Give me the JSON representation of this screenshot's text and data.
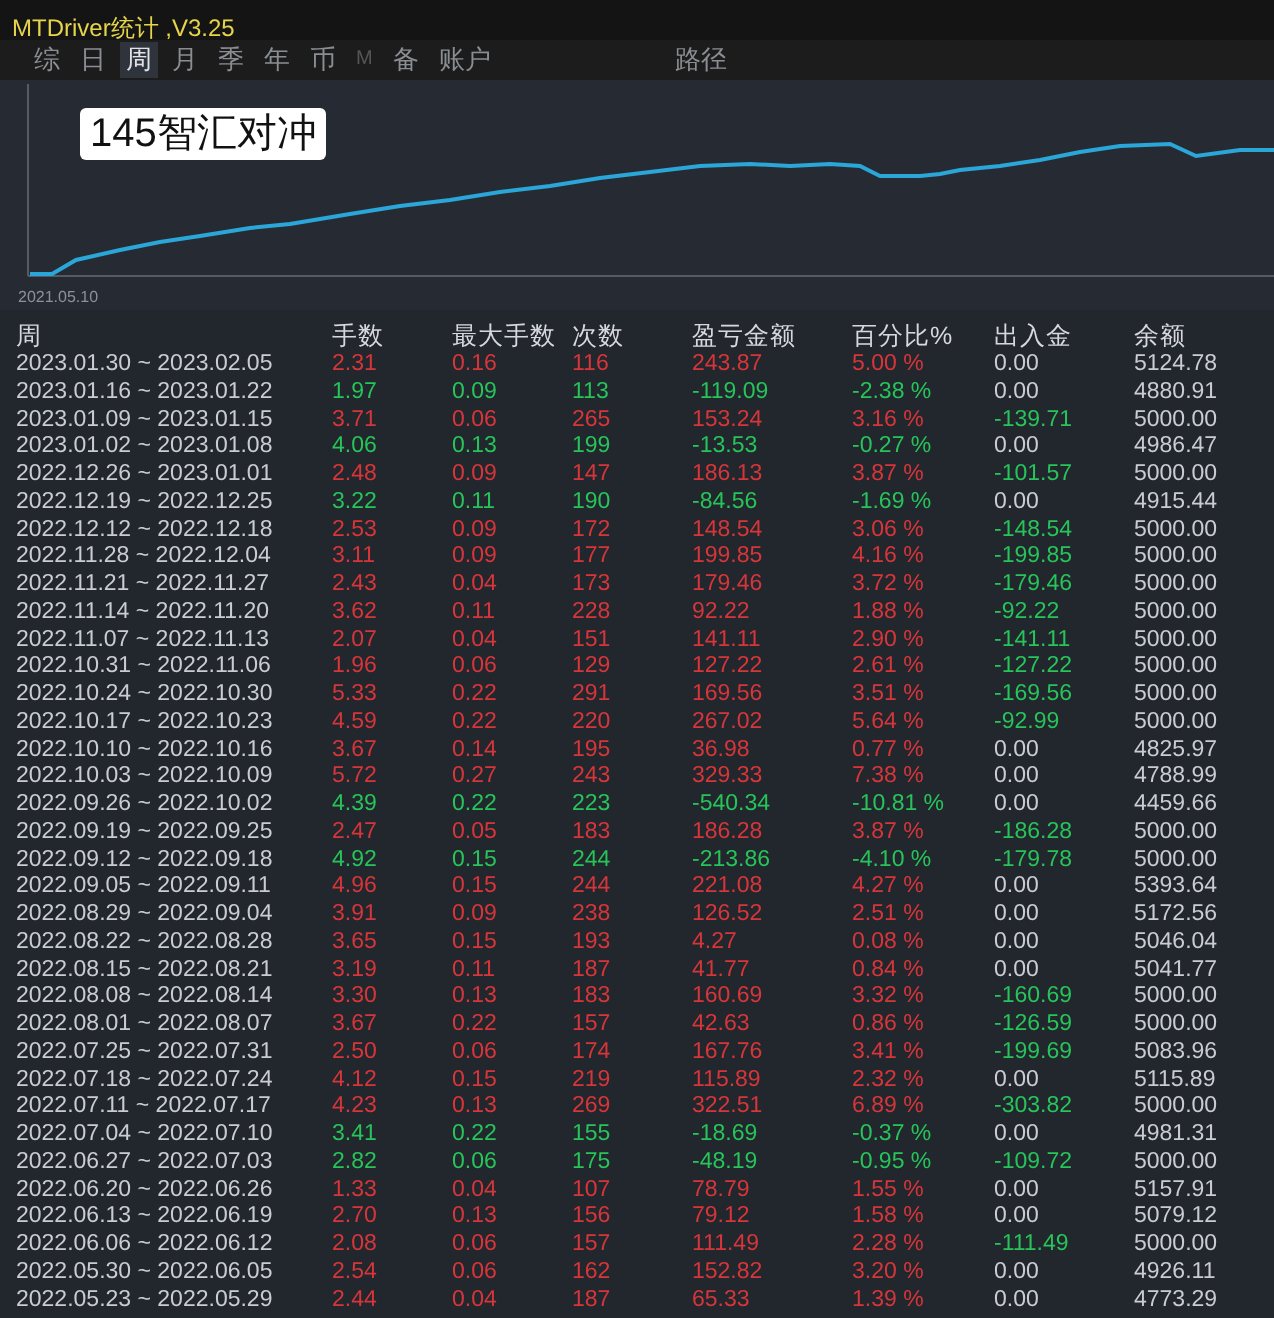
{
  "window": {
    "title": "MTDriver统计 ,V3.25"
  },
  "tabs": [
    {
      "label": "综",
      "selected": false,
      "disabled": false
    },
    {
      "label": "日",
      "selected": false,
      "disabled": false
    },
    {
      "label": "周",
      "selected": true,
      "disabled": false
    },
    {
      "label": "月",
      "selected": false,
      "disabled": false
    },
    {
      "label": "季",
      "selected": false,
      "disabled": false
    },
    {
      "label": "年",
      "selected": false,
      "disabled": false
    },
    {
      "label": "币",
      "selected": false,
      "disabled": false
    },
    {
      "label": "M",
      "selected": false,
      "disabled": true
    },
    {
      "label": "备",
      "selected": false,
      "disabled": false
    },
    {
      "label": "账户",
      "selected": false,
      "disabled": false
    },
    {
      "label": "路径",
      "selected": false,
      "disabled": false,
      "kind": "far"
    }
  ],
  "chart": {
    "account_label": "145智汇对冲",
    "start_date": "2021.05.10"
  },
  "table": {
    "columns": [
      "周",
      "手数",
      "最大手数",
      "次数",
      "盈亏金额",
      "百分比%",
      "出入金",
      "余额"
    ],
    "rows": [
      {
        "week": "2023.01.30 ~ 2023.02.05",
        "loss": false,
        "lots": "2.31",
        "max_lots": "0.16",
        "trades": "116",
        "pnl": "243.87",
        "percent": "5.00 %",
        "withdrawal": false,
        "flow": "0.00",
        "balance": "5124.78"
      },
      {
        "week": "2023.01.16 ~ 2023.01.22",
        "loss": true,
        "lots": "1.97",
        "max_lots": "0.09",
        "trades": "113",
        "pnl": "-119.09",
        "percent": "-2.38 %",
        "withdrawal": false,
        "flow": "0.00",
        "balance": "4880.91"
      },
      {
        "week": "2023.01.09 ~ 2023.01.15",
        "loss": false,
        "lots": "3.71",
        "max_lots": "0.06",
        "trades": "265",
        "pnl": "153.24",
        "percent": "3.16 %",
        "withdrawal": true,
        "flow": "-139.71",
        "balance": "5000.00"
      },
      {
        "week": "2023.01.02 ~ 2023.01.08",
        "loss": true,
        "lots": "4.06",
        "max_lots": "0.13",
        "trades": "199",
        "pnl": "-13.53",
        "percent": "-0.27 %",
        "withdrawal": false,
        "flow": "0.00",
        "balance": "4986.47"
      },
      {
        "week": "2022.12.26 ~ 2023.01.01",
        "loss": false,
        "lots": "2.48",
        "max_lots": "0.09",
        "trades": "147",
        "pnl": "186.13",
        "percent": "3.87 %",
        "withdrawal": true,
        "flow": "-101.57",
        "balance": "5000.00"
      },
      {
        "week": "2022.12.19 ~ 2022.12.25",
        "loss": true,
        "lots": "3.22",
        "max_lots": "0.11",
        "trades": "190",
        "pnl": "-84.56",
        "percent": "-1.69 %",
        "withdrawal": false,
        "flow": "0.00",
        "balance": "4915.44"
      },
      {
        "week": "2022.12.12 ~ 2022.12.18",
        "loss": false,
        "lots": "2.53",
        "max_lots": "0.09",
        "trades": "172",
        "pnl": "148.54",
        "percent": "3.06 %",
        "withdrawal": true,
        "flow": "-148.54",
        "balance": "5000.00"
      },
      {
        "week": "2022.11.28 ~ 2022.12.04",
        "loss": false,
        "lots": "3.11",
        "max_lots": "0.09",
        "trades": "177",
        "pnl": "199.85",
        "percent": "4.16 %",
        "withdrawal": true,
        "flow": "-199.85",
        "balance": "5000.00"
      },
      {
        "week": "2022.11.21 ~ 2022.11.27",
        "loss": false,
        "lots": "2.43",
        "max_lots": "0.04",
        "trades": "173",
        "pnl": "179.46",
        "percent": "3.72 %",
        "withdrawal": true,
        "flow": "-179.46",
        "balance": "5000.00"
      },
      {
        "week": "2022.11.14 ~ 2022.11.20",
        "loss": false,
        "lots": "3.62",
        "max_lots": "0.11",
        "trades": "228",
        "pnl": "92.22",
        "percent": "1.88 %",
        "withdrawal": true,
        "flow": "-92.22",
        "balance": "5000.00"
      },
      {
        "week": "2022.11.07 ~ 2022.11.13",
        "loss": false,
        "lots": "2.07",
        "max_lots": "0.04",
        "trades": "151",
        "pnl": "141.11",
        "percent": "2.90 %",
        "withdrawal": true,
        "flow": "-141.11",
        "balance": "5000.00"
      },
      {
        "week": "2022.10.31 ~ 2022.11.06",
        "loss": false,
        "lots": "1.96",
        "max_lots": "0.06",
        "trades": "129",
        "pnl": "127.22",
        "percent": "2.61 %",
        "withdrawal": true,
        "flow": "-127.22",
        "balance": "5000.00"
      },
      {
        "week": "2022.10.24 ~ 2022.10.30",
        "loss": false,
        "lots": "5.33",
        "max_lots": "0.22",
        "trades": "291",
        "pnl": "169.56",
        "percent": "3.51 %",
        "withdrawal": true,
        "flow": "-169.56",
        "balance": "5000.00"
      },
      {
        "week": "2022.10.17 ~ 2022.10.23",
        "loss": false,
        "lots": "4.59",
        "max_lots": "0.22",
        "trades": "220",
        "pnl": "267.02",
        "percent": "5.64 %",
        "withdrawal": true,
        "flow": "-92.99",
        "balance": "5000.00"
      },
      {
        "week": "2022.10.10 ~ 2022.10.16",
        "loss": false,
        "lots": "3.67",
        "max_lots": "0.14",
        "trades": "195",
        "pnl": "36.98",
        "percent": "0.77 %",
        "withdrawal": false,
        "flow": "0.00",
        "balance": "4825.97"
      },
      {
        "week": "2022.10.03 ~ 2022.10.09",
        "loss": false,
        "lots": "5.72",
        "max_lots": "0.27",
        "trades": "243",
        "pnl": "329.33",
        "percent": "7.38 %",
        "withdrawal": false,
        "flow": "0.00",
        "balance": "4788.99"
      },
      {
        "week": "2022.09.26 ~ 2022.10.02",
        "loss": true,
        "lots": "4.39",
        "max_lots": "0.22",
        "trades": "223",
        "pnl": "-540.34",
        "percent": "-10.81 %",
        "withdrawal": false,
        "flow": "0.00",
        "balance": "4459.66"
      },
      {
        "week": "2022.09.19 ~ 2022.09.25",
        "loss": false,
        "lots": "2.47",
        "max_lots": "0.05",
        "trades": "183",
        "pnl": "186.28",
        "percent": "3.87 %",
        "withdrawal": true,
        "flow": "-186.28",
        "balance": "5000.00"
      },
      {
        "week": "2022.09.12 ~ 2022.09.18",
        "loss": true,
        "lots": "4.92",
        "max_lots": "0.15",
        "trades": "244",
        "pnl": "-213.86",
        "percent": "-4.10 %",
        "withdrawal": true,
        "flow": "-179.78",
        "balance": "5000.00"
      },
      {
        "week": "2022.09.05 ~ 2022.09.11",
        "loss": false,
        "lots": "4.96",
        "max_lots": "0.15",
        "trades": "244",
        "pnl": "221.08",
        "percent": "4.27 %",
        "withdrawal": false,
        "flow": "0.00",
        "balance": "5393.64"
      },
      {
        "week": "2022.08.29 ~ 2022.09.04",
        "loss": false,
        "lots": "3.91",
        "max_lots": "0.09",
        "trades": "238",
        "pnl": "126.52",
        "percent": "2.51 %",
        "withdrawal": false,
        "flow": "0.00",
        "balance": "5172.56"
      },
      {
        "week": "2022.08.22 ~ 2022.08.28",
        "loss": false,
        "lots": "3.65",
        "max_lots": "0.15",
        "trades": "193",
        "pnl": "4.27",
        "percent": "0.08 %",
        "withdrawal": false,
        "flow": "0.00",
        "balance": "5046.04"
      },
      {
        "week": "2022.08.15 ~ 2022.08.21",
        "loss": false,
        "lots": "3.19",
        "max_lots": "0.11",
        "trades": "187",
        "pnl": "41.77",
        "percent": "0.84 %",
        "withdrawal": false,
        "flow": "0.00",
        "balance": "5041.77"
      },
      {
        "week": "2022.08.08 ~ 2022.08.14",
        "loss": false,
        "lots": "3.30",
        "max_lots": "0.13",
        "trades": "183",
        "pnl": "160.69",
        "percent": "3.32 %",
        "withdrawal": true,
        "flow": "-160.69",
        "balance": "5000.00"
      },
      {
        "week": "2022.08.01 ~ 2022.08.07",
        "loss": false,
        "lots": "3.67",
        "max_lots": "0.22",
        "trades": "157",
        "pnl": "42.63",
        "percent": "0.86 %",
        "withdrawal": true,
        "flow": "-126.59",
        "balance": "5000.00"
      },
      {
        "week": "2022.07.25 ~ 2022.07.31",
        "loss": false,
        "lots": "2.50",
        "max_lots": "0.06",
        "trades": "174",
        "pnl": "167.76",
        "percent": "3.41 %",
        "withdrawal": true,
        "flow": "-199.69",
        "balance": "5083.96"
      },
      {
        "week": "2022.07.18 ~ 2022.07.24",
        "loss": false,
        "lots": "4.12",
        "max_lots": "0.15",
        "trades": "219",
        "pnl": "115.89",
        "percent": "2.32 %",
        "withdrawal": false,
        "flow": "0.00",
        "balance": "5115.89"
      },
      {
        "week": "2022.07.11 ~ 2022.07.17",
        "loss": false,
        "lots": "4.23",
        "max_lots": "0.13",
        "trades": "269",
        "pnl": "322.51",
        "percent": "6.89 %",
        "withdrawal": true,
        "flow": "-303.82",
        "balance": "5000.00"
      },
      {
        "week": "2022.07.04 ~ 2022.07.10",
        "loss": true,
        "lots": "3.41",
        "max_lots": "0.22",
        "trades": "155",
        "pnl": "-18.69",
        "percent": "-0.37 %",
        "withdrawal": false,
        "flow": "0.00",
        "balance": "4981.31"
      },
      {
        "week": "2022.06.27 ~ 2022.07.03",
        "loss": true,
        "lots": "2.82",
        "max_lots": "0.06",
        "trades": "175",
        "pnl": "-48.19",
        "percent": "-0.95 %",
        "withdrawal": true,
        "flow": "-109.72",
        "balance": "5000.00"
      },
      {
        "week": "2022.06.20 ~ 2022.06.26",
        "loss": false,
        "lots": "1.33",
        "max_lots": "0.04",
        "trades": "107",
        "pnl": "78.79",
        "percent": "1.55 %",
        "withdrawal": false,
        "flow": "0.00",
        "balance": "5157.91"
      },
      {
        "week": "2022.06.13 ~ 2022.06.19",
        "loss": false,
        "lots": "2.70",
        "max_lots": "0.13",
        "trades": "156",
        "pnl": "79.12",
        "percent": "1.58 %",
        "withdrawal": false,
        "flow": "0.00",
        "balance": "5079.12"
      },
      {
        "week": "2022.06.06 ~ 2022.06.12",
        "loss": false,
        "lots": "2.08",
        "max_lots": "0.06",
        "trades": "157",
        "pnl": "111.49",
        "percent": "2.28 %",
        "withdrawal": true,
        "flow": "-111.49",
        "balance": "5000.00"
      },
      {
        "week": "2022.05.30 ~ 2022.06.05",
        "loss": false,
        "lots": "2.54",
        "max_lots": "0.06",
        "trades": "162",
        "pnl": "152.82",
        "percent": "3.20 %",
        "withdrawal": false,
        "flow": "0.00",
        "balance": "4926.11"
      },
      {
        "week": "2022.05.23 ~ 2022.05.29",
        "loss": false,
        "lots": "2.44",
        "max_lots": "0.04",
        "trades": "187",
        "pnl": "65.33",
        "percent": "1.39 %",
        "withdrawal": false,
        "flow": "0.00",
        "balance": "4773.29"
      }
    ]
  }
}
